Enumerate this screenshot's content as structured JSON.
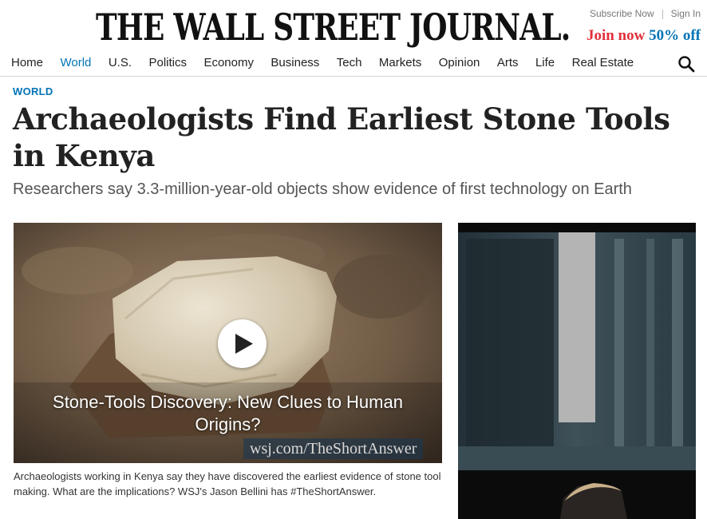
{
  "masthead": {
    "logo": "THE WALL STREET JOURNAL.",
    "subscribe_label": "Subscribe Now",
    "signin_label": "Sign In",
    "promo_join": "Join now",
    "promo_offer": "50% off",
    "promo_join_color": "#e0303b",
    "promo_offer_color": "#0274b6"
  },
  "nav": {
    "items": [
      {
        "label": "Home"
      },
      {
        "label": "World",
        "active": true
      },
      {
        "label": "U.S."
      },
      {
        "label": "Politics"
      },
      {
        "label": "Economy"
      },
      {
        "label": "Business"
      },
      {
        "label": "Tech"
      },
      {
        "label": "Markets"
      },
      {
        "label": "Opinion"
      },
      {
        "label": "Arts"
      },
      {
        "label": "Life"
      },
      {
        "label": "Real Estate"
      }
    ],
    "active_color": "#0274b6",
    "search_icon": "search-icon"
  },
  "article": {
    "section": "WORLD",
    "headline": "Archaeologists Find Earliest Stone Tools in Kenya",
    "dek": "Researchers say 3.3-million-year-old objects show evidence of first technology on Earth",
    "video": {
      "title": "Stone-Tools Discovery: New Clues to Human Origins?",
      "url_overlay": "wsj.com/TheShortAnswer",
      "play_icon": "play-icon"
    },
    "caption": "Archaeologists working in Kenya say they have discovered the earliest evidence of stone tool making. What are the implications? WSJ's Jason Bellini has #TheShortAnswer."
  }
}
